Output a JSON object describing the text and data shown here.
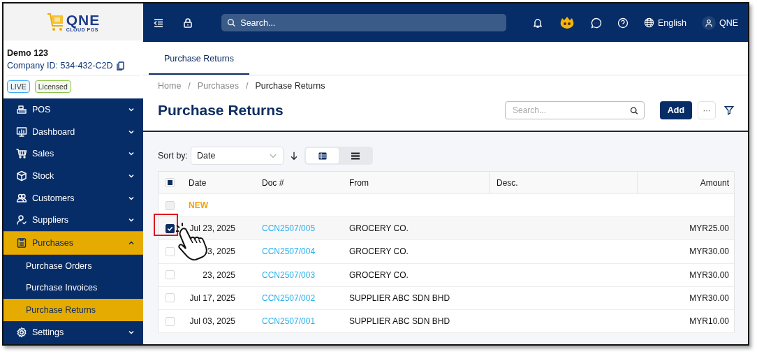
{
  "logo": {
    "name": "QNE",
    "tagline": "CLOUD POS"
  },
  "company": {
    "name": "Demo 123",
    "id": "Company ID: 534-432-C2D",
    "badges": [
      {
        "label": "LIVE",
        "color": "#3fa9f5"
      },
      {
        "label": "Licensed",
        "color": "#8bc34a"
      }
    ]
  },
  "sidebar": {
    "items": [
      {
        "label": "POS",
        "expanded": false,
        "selected": false
      },
      {
        "label": "Dashboard",
        "expanded": false,
        "selected": false
      },
      {
        "label": "Sales",
        "expanded": false,
        "selected": false
      },
      {
        "label": "Stock",
        "expanded": false,
        "selected": false
      },
      {
        "label": "Customers",
        "expanded": false,
        "selected": false
      },
      {
        "label": "Suppliers",
        "expanded": false,
        "selected": false
      },
      {
        "label": "Purchases",
        "expanded": true,
        "selected": true,
        "children": [
          {
            "label": "Purchase Orders",
            "selected": false
          },
          {
            "label": "Purchase Invoices",
            "selected": false
          },
          {
            "label": "Purchase Returns",
            "selected": true
          }
        ]
      },
      {
        "label": "Settings",
        "expanded": false,
        "selected": false
      }
    ]
  },
  "topbar": {
    "search": {
      "placeholder": "Search..."
    },
    "language": "English",
    "user": "QNE"
  },
  "tabs": [
    {
      "label": "Purchase Returns",
      "selected": true
    }
  ],
  "breadcrumb": {
    "separator": "/",
    "items": [
      "Home",
      "Purchases",
      "Purchase Returns"
    ]
  },
  "page": {
    "title": "Purchase Returns",
    "search": {
      "placeholder": "Search..."
    },
    "add_button": "Add",
    "more_button": "···"
  },
  "sort": {
    "label": "Sort by:",
    "value": "Date"
  },
  "views": [
    {
      "kind": "table",
      "selected": true
    },
    {
      "kind": "list",
      "selected": false
    }
  ],
  "table": {
    "header_checkbox": {
      "indeterminate": true
    },
    "columns": [
      "Date",
      "Doc #",
      "From",
      "Desc.",
      "Amount"
    ],
    "groups": [
      {
        "label": "NEW",
        "checked": false,
        "rows": [
          {
            "checked": true,
            "date": "Jul 23, 2025",
            "doc": "CCN2507/005",
            "from": "GROCERY CO.",
            "amount": "MYR25.00"
          },
          {
            "checked": false,
            "date": "3, 2025",
            "doc": "CCN2507/004",
            "from": "GROCERY CO.",
            "amount": "MYR30.00"
          },
          {
            "checked": false,
            "date": "23, 2025",
            "doc": "CCN2507/003",
            "from": "GROCERY CO.",
            "amount": "MYR30.00"
          },
          {
            "checked": false,
            "date": "Jul 17, 2025",
            "doc": "CCN2507/002",
            "from": "SUPPLIER ABC SDN BHD",
            "amount": "MYR30.00"
          },
          {
            "checked": false,
            "date": "Jul 03, 2025",
            "doc": "CCN2507/001",
            "from": "SUPPLIER ABC SDN BHD",
            "amount": "MYR10.00"
          }
        ]
      }
    ]
  }
}
